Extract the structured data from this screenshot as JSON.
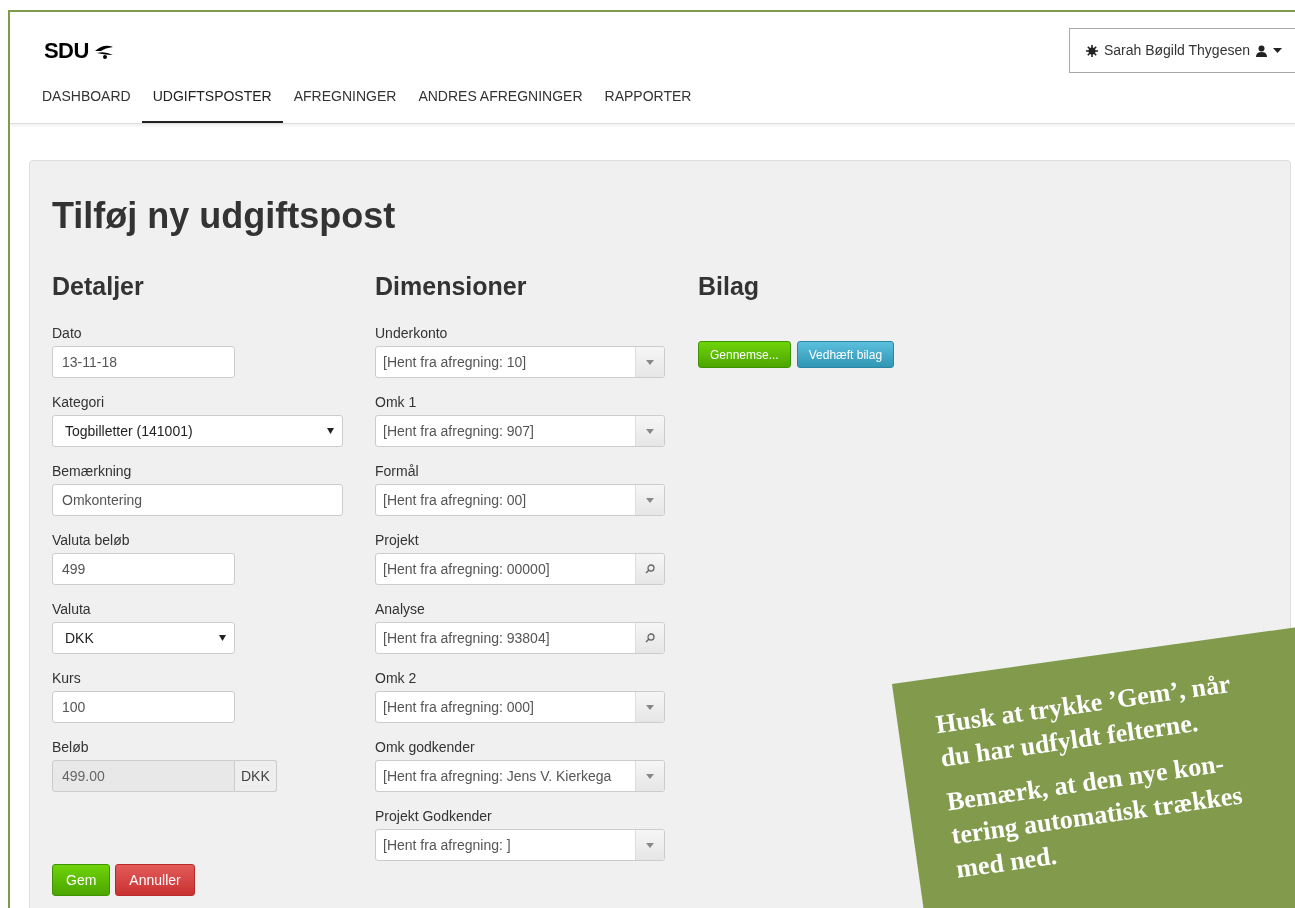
{
  "logo": "SDU",
  "user_menu": {
    "name": "Sarah Bøgild Thygesen"
  },
  "nav": [
    {
      "label": "DASHBOARD",
      "selected": false
    },
    {
      "label": "UDGIFTSPOSTER",
      "selected": true
    },
    {
      "label": "AFREGNINGER",
      "selected": false
    },
    {
      "label": "ANDRES AFREGNINGER",
      "selected": false
    },
    {
      "label": "RAPPORTER",
      "selected": false
    }
  ],
  "title": "Tilføj ny udgiftspost",
  "details": {
    "heading": "Detaljer",
    "fields": [
      {
        "label": "Dato",
        "kind": "text",
        "value": "13-11-18"
      },
      {
        "label": "Kategori",
        "kind": "select",
        "value": "Togbilletter (141001)"
      },
      {
        "label": "Bemærkning",
        "kind": "text",
        "value": "Omkontering"
      },
      {
        "label": "Valuta beløb",
        "kind": "text",
        "value": "499"
      },
      {
        "label": "Valuta",
        "kind": "select",
        "value": "DKK"
      },
      {
        "label": "Kurs",
        "kind": "text",
        "value": "100"
      },
      {
        "label": "Beløb",
        "kind": "addon",
        "value": "499.00",
        "addon": "DKK",
        "disabled": true
      }
    ]
  },
  "dimensions": {
    "heading": "Dimensioner",
    "fields": [
      {
        "label": "Underkonto",
        "kind": "dropdown",
        "value": "[Hent fra afregning: 10]"
      },
      {
        "label": "Omk 1",
        "kind": "dropdown",
        "value": "[Hent fra afregning: 907]"
      },
      {
        "label": "Formål",
        "kind": "dropdown",
        "value": "[Hent fra afregning: 00]"
      },
      {
        "label": "Projekt",
        "kind": "search",
        "value": "[Hent fra afregning: 00000]"
      },
      {
        "label": "Analyse",
        "kind": "search",
        "value": "[Hent fra afregning: 93804]"
      },
      {
        "label": "Omk 2",
        "kind": "dropdown",
        "value": "[Hent fra afregning: 000]"
      },
      {
        "label": "Omk godkender",
        "kind": "dropdown",
        "value": "[Hent fra afregning: Jens V. Kierkega"
      },
      {
        "label": "Projekt Godkender",
        "kind": "dropdown",
        "value": "[Hent fra afregning: ]"
      }
    ]
  },
  "attachments": {
    "heading": "Bilag",
    "buttons": [
      {
        "label": "Gennemse...",
        "kind": "success"
      },
      {
        "label": "Vedhæft bilag",
        "kind": "info"
      }
    ]
  },
  "actions": [
    {
      "label": "Gem",
      "kind": "success"
    },
    {
      "label": "Annuller",
      "kind": "danger"
    }
  ],
  "note": {
    "paragraphs": [
      [
        "Husk at trykke ’Gem’, når",
        "du har udfyldt felterne."
      ],
      [
        "Bemærk, at den nye kon-",
        "tering automatisk trækkes",
        "med ned."
      ]
    ]
  }
}
